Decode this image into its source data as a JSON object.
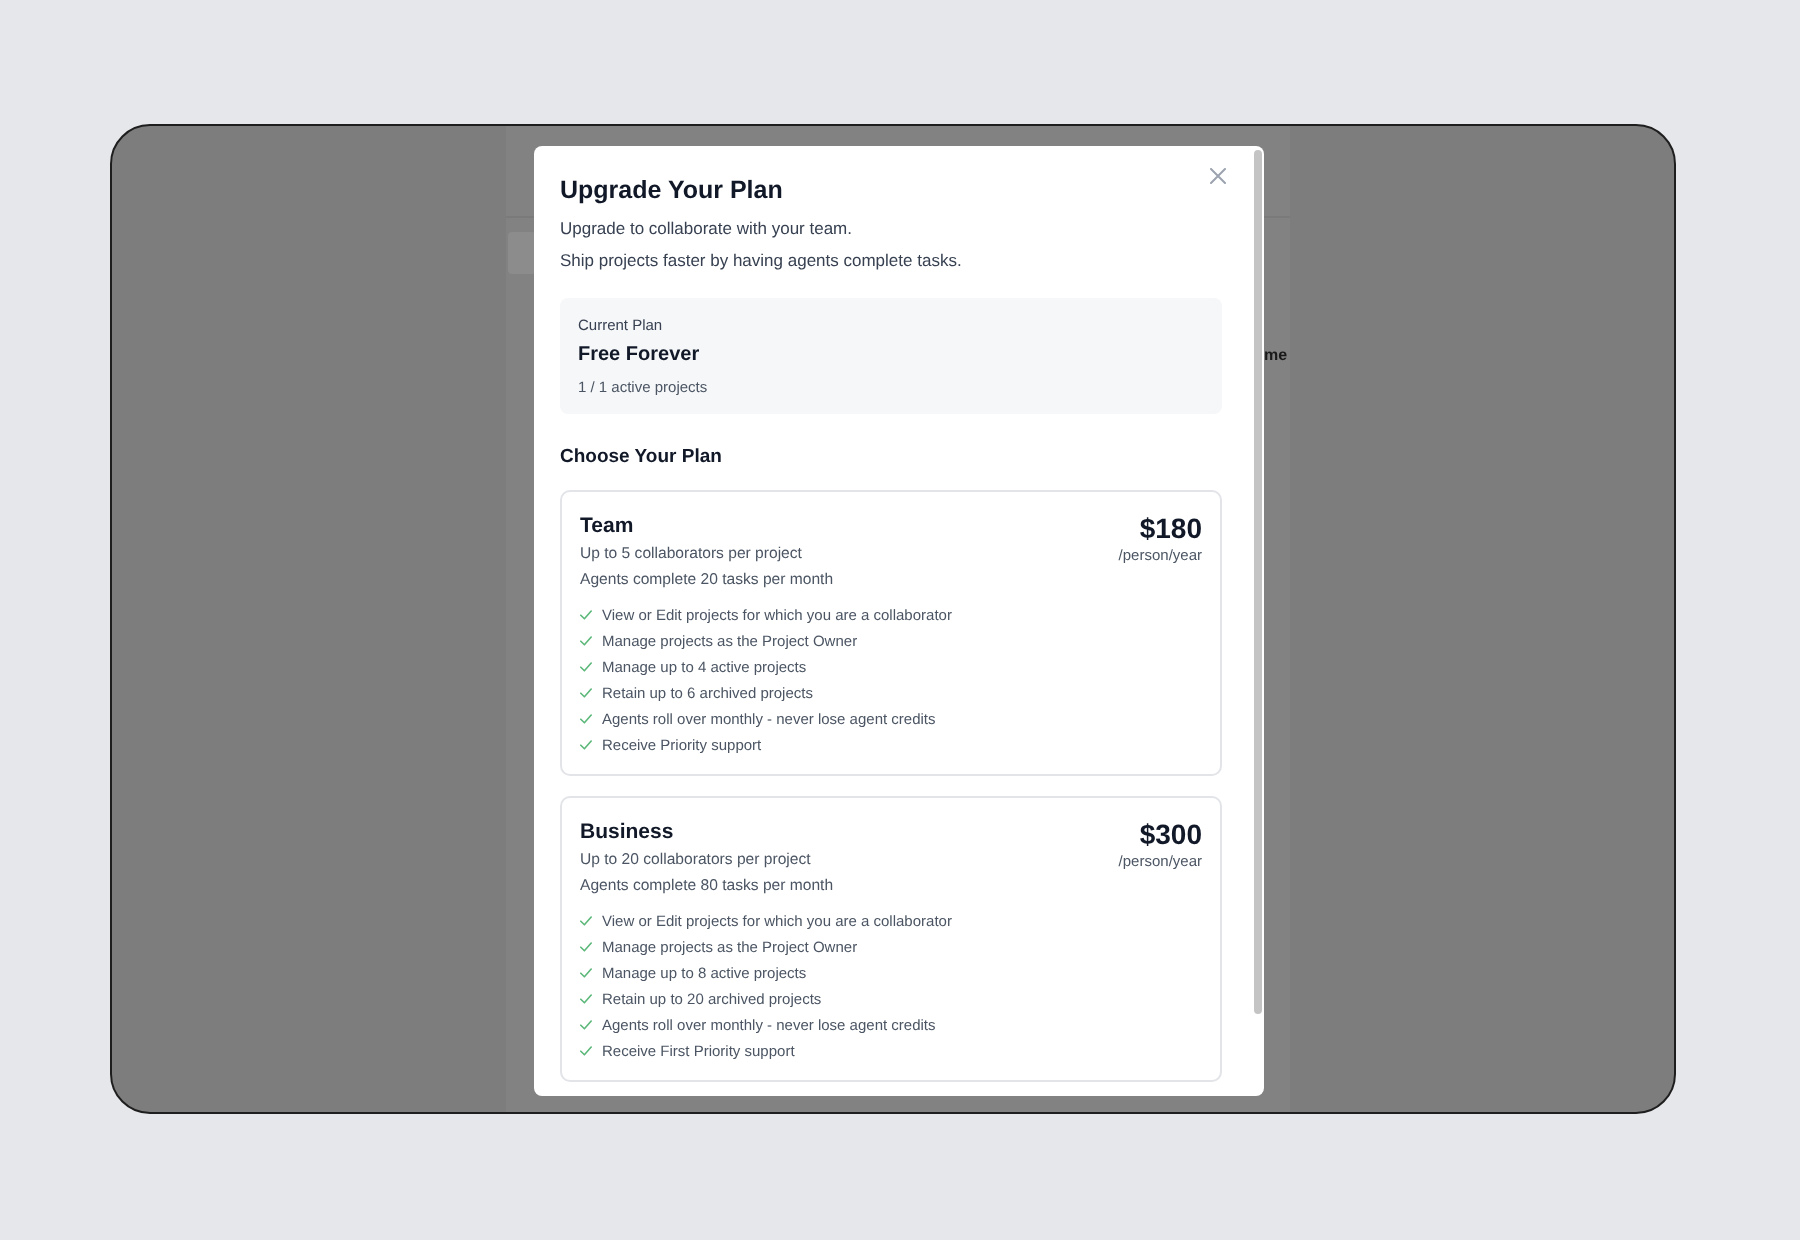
{
  "backdrop": {
    "column_fragment": "me"
  },
  "dialog": {
    "title": "Upgrade Your Plan",
    "description": [
      "Upgrade to collaborate with your team.",
      "Ship projects faster by having agents complete tasks."
    ]
  },
  "current_plan": {
    "label": "Current Plan",
    "name": "Free Forever",
    "usage": "1 / 1 active projects"
  },
  "plans_heading": "Choose Your Plan",
  "plans": [
    {
      "name": "Team",
      "price": "$180",
      "period": "/person/year",
      "details": [
        "Up to 5 collaborators per project",
        "Agents complete 20 tasks per month"
      ],
      "features": [
        "View or Edit projects for which you are a collaborator",
        "Manage projects as the Project Owner",
        "Manage up to 4 active projects",
        "Retain up to 6 archived projects",
        "Agents roll over monthly - never lose agent credits",
        "Receive Priority support"
      ]
    },
    {
      "name": "Business",
      "price": "$300",
      "period": "/person/year",
      "details": [
        "Up to 20 collaborators per project",
        "Agents complete 80 tasks per month"
      ],
      "features": [
        "View or Edit projects for which you are a collaborator",
        "Manage projects as the Project Owner",
        "Manage up to 8 active projects",
        "Retain up to 20 archived projects",
        "Agents roll over monthly - never lose agent credits",
        "Receive First Priority support"
      ]
    }
  ]
}
